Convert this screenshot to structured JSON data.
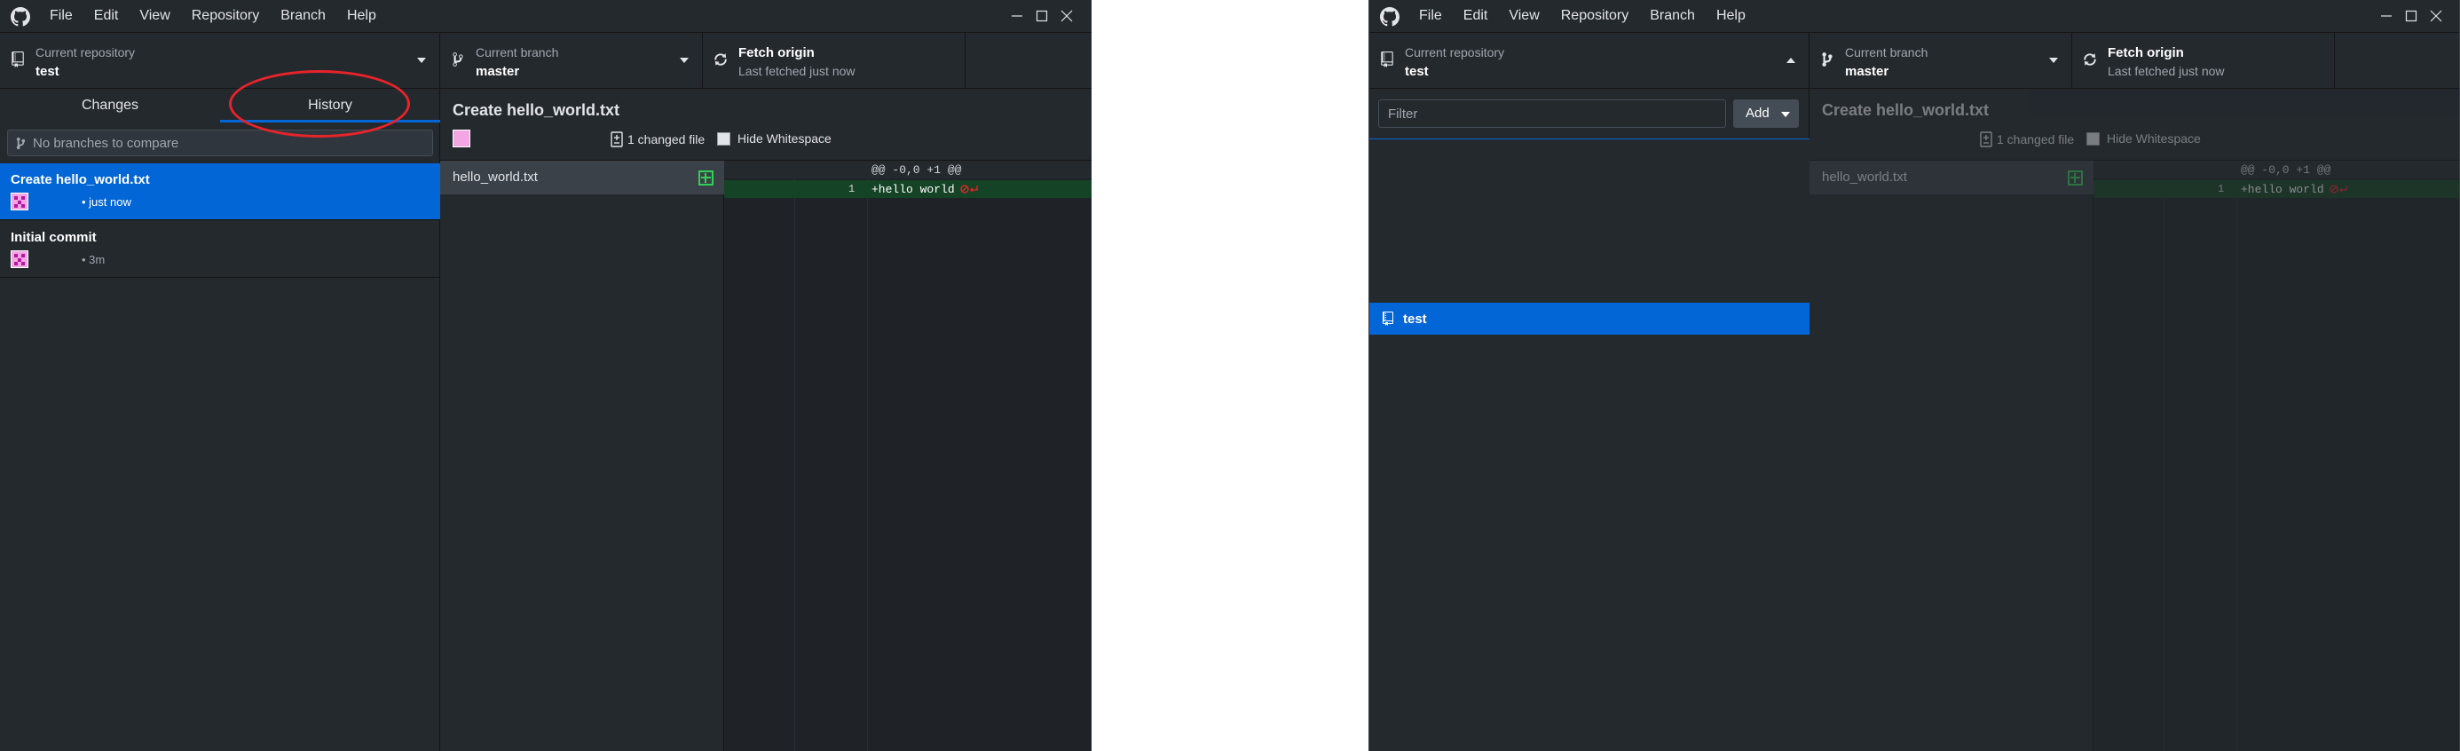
{
  "window_a": {
    "menu": [
      "File",
      "Edit",
      "View",
      "Repository",
      "Branch",
      "Help"
    ],
    "toolbar": {
      "repo_label": "Current repository",
      "repo_name": "test",
      "branch_label": "Current branch",
      "branch_name": "master",
      "fetch_title": "Fetch origin",
      "fetch_sub": "Last fetched just now"
    },
    "tabs": {
      "changes": "Changes",
      "history": "History",
      "active": "History"
    },
    "compare_placeholder": "No branches to compare",
    "commits": [
      {
        "title": "Create hello_world.txt",
        "meta": "• just now",
        "selected": true
      },
      {
        "title": "Initial commit",
        "meta": "• 3m",
        "selected": false
      }
    ],
    "detail": {
      "title": "Create hello_world.txt",
      "changed_files": "1 changed file",
      "hide_whitespace": "Hide Whitespace",
      "file": "hello_world.txt",
      "hunk_header": "@@ -0,0 +1 @@",
      "line_number": "1",
      "added_line": "+hello world"
    },
    "annotation_color": "#e8232a"
  },
  "window_b": {
    "menu": [
      "File",
      "Edit",
      "View",
      "Repository",
      "Branch",
      "Help"
    ],
    "toolbar": {
      "repo_label": "Current repository",
      "repo_name": "test",
      "branch_label": "Current branch",
      "branch_name": "master",
      "fetch_title": "Fetch origin",
      "fetch_sub": "Last fetched just now"
    },
    "filter_placeholder": "Filter",
    "add_button": "Add",
    "repositories": [
      "test"
    ],
    "detail": {
      "title": "Create hello_world.txt",
      "changed_files": "1 changed file",
      "hide_whitespace": "Hide Whitespace",
      "file": "hello_world.txt",
      "hunk_header": "@@ -0,0 +1 @@",
      "line_number": "1",
      "added_line": "+hello world"
    }
  },
  "colors": {
    "accent": "#0366d6",
    "background": "#24292e",
    "diff_added": "#154325",
    "added_icon": "#34d058"
  },
  "icons": [
    "github-logo-icon",
    "repo-icon",
    "branch-icon",
    "sync-icon",
    "caret-down-icon",
    "caret-up-icon",
    "minimize-icon",
    "maximize-icon",
    "close-icon",
    "file-diff-icon",
    "file-added-icon",
    "no-newline-icon"
  ]
}
